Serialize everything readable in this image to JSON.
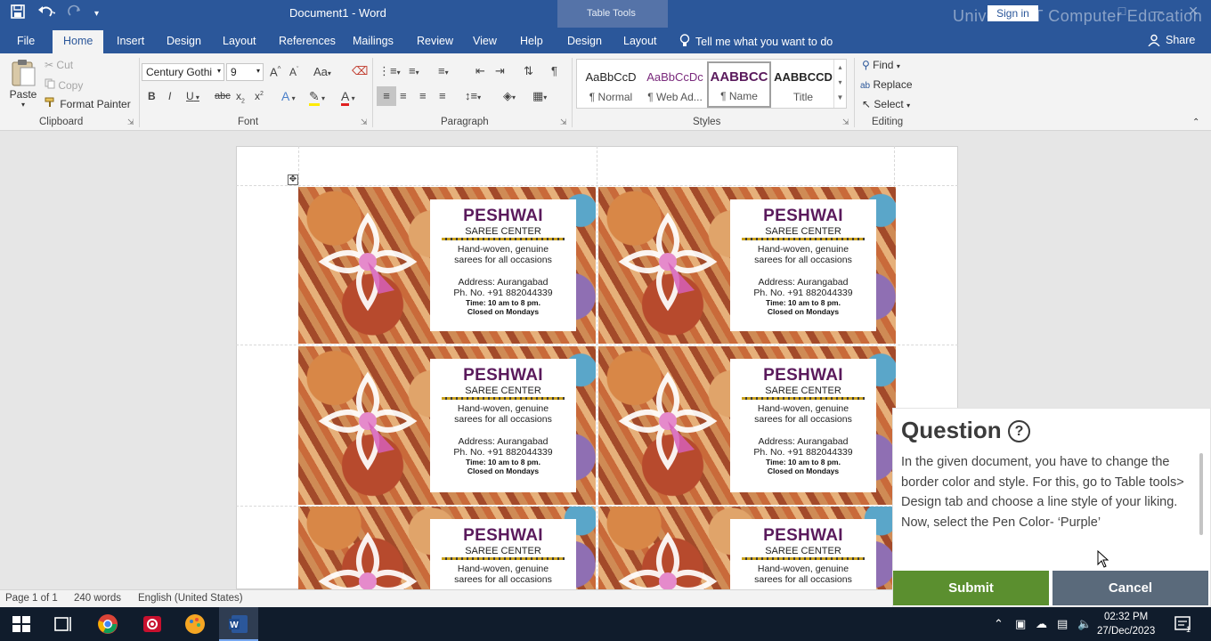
{
  "titlebar": {
    "doc_title": "Document1  -  Word",
    "table_tools": "Table Tools",
    "sign_in": "Sign in",
    "watermark": "Universal IT Computer Education"
  },
  "tabs": {
    "file": "File",
    "home": "Home",
    "insert": "Insert",
    "design": "Design",
    "layout": "Layout",
    "references": "References",
    "mailings": "Mailings",
    "review": "Review",
    "view": "View",
    "help": "Help",
    "tt_design": "Design",
    "tt_layout": "Layout",
    "tell_me": "Tell me what you want to do",
    "share": "Share"
  },
  "clipboard": {
    "paste": "Paste",
    "cut": "Cut",
    "copy": "Copy",
    "format_painter": "Format Painter",
    "label": "Clipboard"
  },
  "font": {
    "family": "Century Gothi",
    "size": "9",
    "label": "Font"
  },
  "paragraph": {
    "label": "Paragraph"
  },
  "styles": {
    "label": "Styles",
    "items": [
      {
        "sample": "AaBbCcD",
        "name": "¶ Normal"
      },
      {
        "sample": "AaBbCcDc",
        "name": "¶ Web Ad..."
      },
      {
        "sample": "AABBCC",
        "name": "¶ Name"
      },
      {
        "sample": "AABBCCD",
        "name": "Title"
      }
    ]
  },
  "editing": {
    "find": "Find",
    "replace": "Replace",
    "select": "Select",
    "label": "Editing"
  },
  "card": {
    "name": "PESHWAI",
    "subtitle": "SAREE CENTER",
    "tagline1": "Hand-woven, genuine",
    "tagline2": "sarees for all occasions",
    "address": "Address: Aurangabad",
    "phone": "Ph. No. +91 882044339",
    "time": "Time: 10 am to 8 pm.",
    "closed": "Closed on Mondays"
  },
  "question": {
    "title": "Question",
    "help_glyph": "?",
    "text": "In the given document, you have to change the border color and style. For this, go to Table tools> Design tab and choose a line style of your liking. Now, select the Pen Color- ‘Purple’",
    "submit": "Submit",
    "cancel": "Cancel"
  },
  "statusbar": {
    "page": "Page 1 of 1",
    "words": "240 words",
    "language": "English (United States)"
  },
  "taskbar": {
    "time": "02:32 PM",
    "date": "27/Dec/2023",
    "notifications": "1"
  },
  "colors": {
    "word_blue": "#2b579a",
    "brand_purple": "#5a1a5c",
    "submit_green": "#5b8f2f",
    "cancel_slate": "#5a6a7b"
  }
}
